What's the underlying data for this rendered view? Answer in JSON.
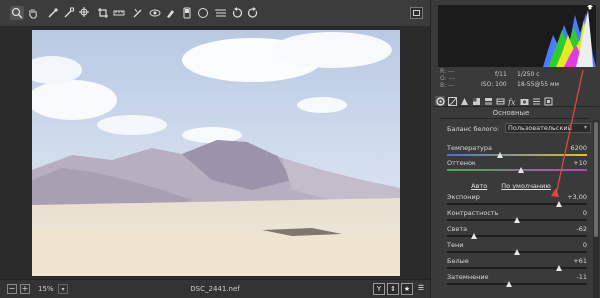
{
  "toolbar": {
    "tools": [
      "zoom-icon",
      "hand-icon",
      "white-balance-icon",
      "color-sampler-icon",
      "target-adjust-icon",
      "crop-icon",
      "straighten-icon",
      "spot-removal-icon",
      "red-eye-icon",
      "adjustment-brush-icon",
      "graduated-filter-icon",
      "radial-filter-icon",
      "preferences-icon",
      "rotate-ccw-icon",
      "rotate-cw-icon",
      "fullscreen-icon"
    ]
  },
  "status": {
    "zoom_minus": "−",
    "zoom_plus": "+",
    "zoom": "15%",
    "filename": "DSC_2441.nef",
    "mode_y": "Y",
    "mode_before_after": "⇕",
    "mode_star": "★",
    "mode_settings": "☰"
  },
  "info": {
    "r": "R:  ---",
    "g": "G:  ---",
    "b": "B:  ---",
    "aperture": "f/11",
    "shutter": "1/250 с",
    "iso": "ISO: 100",
    "lens": "18-55@55 мм"
  },
  "panel": {
    "section_title": "Основные",
    "wb_label": "Баланс белого:",
    "wb_value": "Пользовательский",
    "auto_link": "Авто",
    "default_link": "По умолчанию"
  },
  "sliders": [
    {
      "label": "Температура",
      "value": "6200",
      "level": 0.38,
      "gradient": "linear-gradient(90deg,#4d6fd0,#d9c33a)"
    },
    {
      "label": "Оттенок",
      "value": "+10",
      "level": 0.53,
      "gradient": "linear-gradient(90deg,#3db34a,#c23fc2)"
    },
    {
      "label": "Экспонир",
      "value": "+3,00",
      "level": 0.8,
      "gradient": ""
    },
    {
      "label": "Контрастность",
      "value": "0",
      "level": 0.5,
      "gradient": ""
    },
    {
      "label": "Света",
      "value": "-62",
      "level": 0.19,
      "gradient": ""
    },
    {
      "label": "Тени",
      "value": "0",
      "level": 0.5,
      "gradient": ""
    },
    {
      "label": "Белые",
      "value": "+61",
      "level": 0.8,
      "gradient": ""
    },
    {
      "label": "Затемнение",
      "value": "-11",
      "level": 0.44,
      "gradient": ""
    }
  ],
  "colors": {
    "annotation_arrow": "#e0463c"
  }
}
